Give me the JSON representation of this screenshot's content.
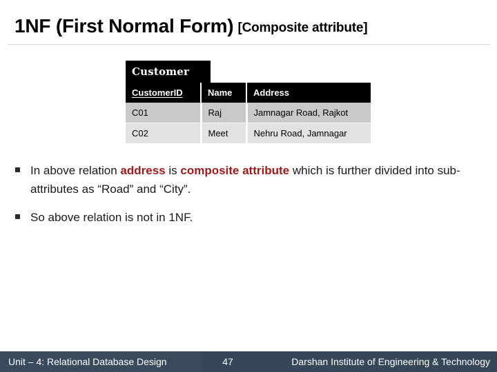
{
  "slide": {
    "title_main": "1NF (First Normal Form)",
    "title_sub": "[Composite attribute]"
  },
  "table": {
    "caption": "Customer",
    "columns": [
      {
        "label": "CustomerID",
        "underlined": true
      },
      {
        "label": "Name",
        "underlined": false
      },
      {
        "label": "Address",
        "underlined": false
      }
    ],
    "rows": [
      {
        "customer_id": "C01",
        "name": "Raj",
        "address": "Jamnagar Road, Rajkot"
      },
      {
        "customer_id": "C02",
        "name": "Meet",
        "address": "Nehru Road, Jamnagar"
      }
    ]
  },
  "bullets": [
    {
      "segments": [
        {
          "text": "In above relation ",
          "accent": false
        },
        {
          "text": "address",
          "accent": true
        },
        {
          "text": " is ",
          "accent": false
        },
        {
          "text": "composite attribute",
          "accent": true
        },
        {
          "text": " which is further divided into sub-attributes as “Road” and “City”.",
          "accent": false
        }
      ]
    },
    {
      "segments": [
        {
          "text": "So above relation is not in 1NF.",
          "accent": false
        }
      ]
    }
  ],
  "footer": {
    "unit": "Unit – 4: Relational Database Design",
    "page_number": "47",
    "organization": "Darshan Institute of Engineering & Technology"
  },
  "colors": {
    "accent_red": "#9e1b1b",
    "footer_bar": "#37475a",
    "header_black": "#000000",
    "row_a": "#c9c9c9",
    "row_b": "#e2e2e2"
  }
}
